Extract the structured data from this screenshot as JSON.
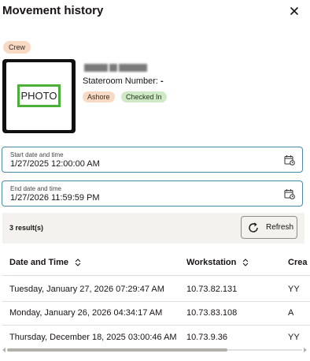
{
  "header": {
    "title": "Movement history",
    "close_icon": "close-icon"
  },
  "profile": {
    "category_badge": "Crew",
    "photo_label": "PHOTO",
    "stateroom_label": "Stateroom Number:",
    "stateroom_value": "-",
    "status_badges": [
      {
        "label": "Ashore",
        "color": "#f7d9c4"
      },
      {
        "label": "Checked In",
        "color": "#cfe8c6"
      }
    ]
  },
  "filters": {
    "start": {
      "label": "Start date and time",
      "value": "1/27/2025 12:00:00 AM",
      "icon": "calendar-icon"
    },
    "end": {
      "label": "End date and time",
      "value": "1/27/2026 11:59:59 PM",
      "icon": "calendar-icon"
    }
  },
  "toolbar": {
    "results": "3 result(s)",
    "refresh_label": "Refresh",
    "refresh_icon": "refresh-icon"
  },
  "table": {
    "columns": [
      "Date and Time",
      "Workstation",
      "Crea"
    ],
    "rows": [
      [
        "Tuesday, January 27, 2026 07:29:47 AM",
        "10.73.82.131",
        "YY"
      ],
      [
        "Monday, January 26, 2026 04:34:17 AM",
        "10.73.83.108",
        "A"
      ],
      [
        "Thursday, December 18, 2025 03:00:46 AM",
        "10.73.9.36",
        "YY"
      ]
    ]
  },
  "colors": {
    "accent_border": "#4b8aa8",
    "photo_frame": "#4caf3a",
    "toolbar_bg": "#f4f2ef"
  }
}
